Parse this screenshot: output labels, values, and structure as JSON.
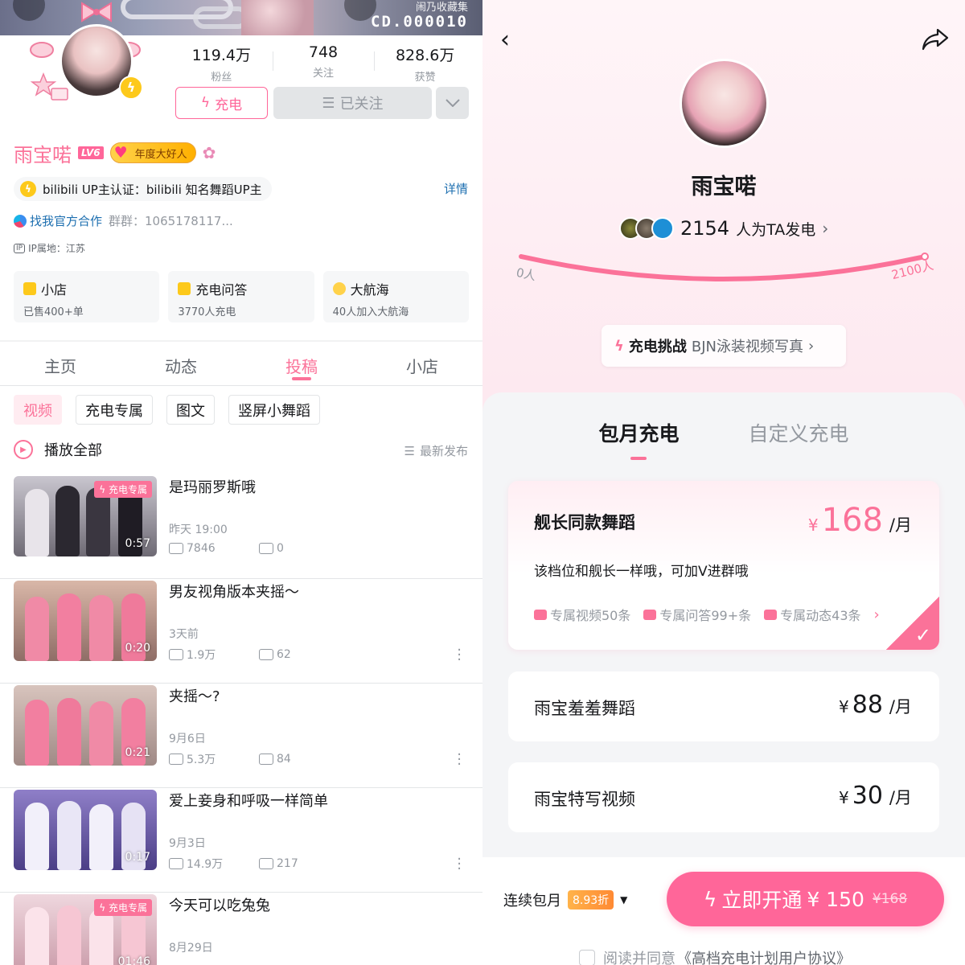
{
  "left": {
    "banner": {
      "code": "CD.000010",
      "collection": "闹乃收藏集"
    },
    "stats": [
      {
        "num": "119.4万",
        "label": "粉丝"
      },
      {
        "num": "748",
        "label": "关注"
      },
      {
        "num": "828.6万",
        "label": "获赞"
      }
    ],
    "buttons": {
      "charge": "充电",
      "followed": "已关注"
    },
    "profile": {
      "name": "雨宝喏",
      "level": "LV6",
      "badge": "年度大好人",
      "verify": "bilibili UP主认证：bilibili 知名舞蹈UP主",
      "detail": "详情",
      "coop": "找我官方合作",
      "group": "群群：1065178117...",
      "ip": "IP属地：江苏"
    },
    "cards": [
      {
        "title": "小店",
        "sub": "已售400+单"
      },
      {
        "title": "充电问答",
        "sub": "3770人充电"
      },
      {
        "title": "大航海",
        "sub": "40人加入大航海"
      }
    ],
    "tabs": [
      "主页",
      "动态",
      "投稿",
      "小店"
    ],
    "subtabs": [
      "视频",
      "充电专属",
      "图文",
      "竖屏小舞蹈"
    ],
    "playall": "播放全部",
    "sort": "最新发布",
    "exclusive_tag": "充电专属",
    "videos": [
      {
        "title": "是玛丽罗斯哦",
        "date": "昨天 19:00",
        "plays": "7846",
        "comments": "0",
        "duration": "0:57",
        "exclusive": true
      },
      {
        "title": "男友视角版本夹摇～",
        "date": "3天前",
        "plays": "1.9万",
        "comments": "62",
        "duration": "0:20",
        "exclusive": false
      },
      {
        "title": "夹摇～?",
        "date": "9月6日",
        "plays": "5.3万",
        "comments": "84",
        "duration": "0:21",
        "exclusive": false
      },
      {
        "title": "爱上妾身和呼吸一样简单",
        "date": "9月3日",
        "plays": "14.9万",
        "comments": "217",
        "duration": "0:17",
        "exclusive": false
      },
      {
        "title": "今天可以吃兔兔",
        "date": "8月29日",
        "plays": "",
        "comments": "",
        "duration": "01:46",
        "exclusive": true
      }
    ]
  },
  "right": {
    "name": "雨宝喏",
    "supporters_count": "2154",
    "supporters_text": "人为TA发电",
    "goal_start": "0人",
    "goal_end": "2100人",
    "challenge_label": "充电挑战",
    "challenge_desc": "BJN泳装视频写真",
    "tabs": [
      "包月充电",
      "自定义充电"
    ],
    "tiers": [
      {
        "name": "舰长同款舞蹈",
        "currency": "¥",
        "price": "168",
        "per": "/月",
        "desc": "该档位和舰长一样哦，可加V进群哦",
        "perks": [
          "专属视频50条",
          "专属问答99+条",
          "专属动态43条"
        ]
      },
      {
        "name": "雨宝羞羞舞蹈",
        "currency": "¥",
        "price": "88",
        "per": "/月"
      },
      {
        "name": "雨宝特写视频",
        "currency": "¥",
        "price": "30",
        "per": "/月"
      }
    ],
    "bottom": {
      "monthly": "连续包月",
      "discount": "8.93折",
      "open_label": "立即开通",
      "open_price": "¥ 150",
      "old_price": "¥168",
      "agree_prefix": "阅读并同意",
      "agree_doc": "《高档充电计划用户协议》"
    }
  },
  "colors": {
    "accent": "#fb7299",
    "button": "#ff6699",
    "link": "#1d6fb0",
    "gold": "#fdc91b"
  }
}
